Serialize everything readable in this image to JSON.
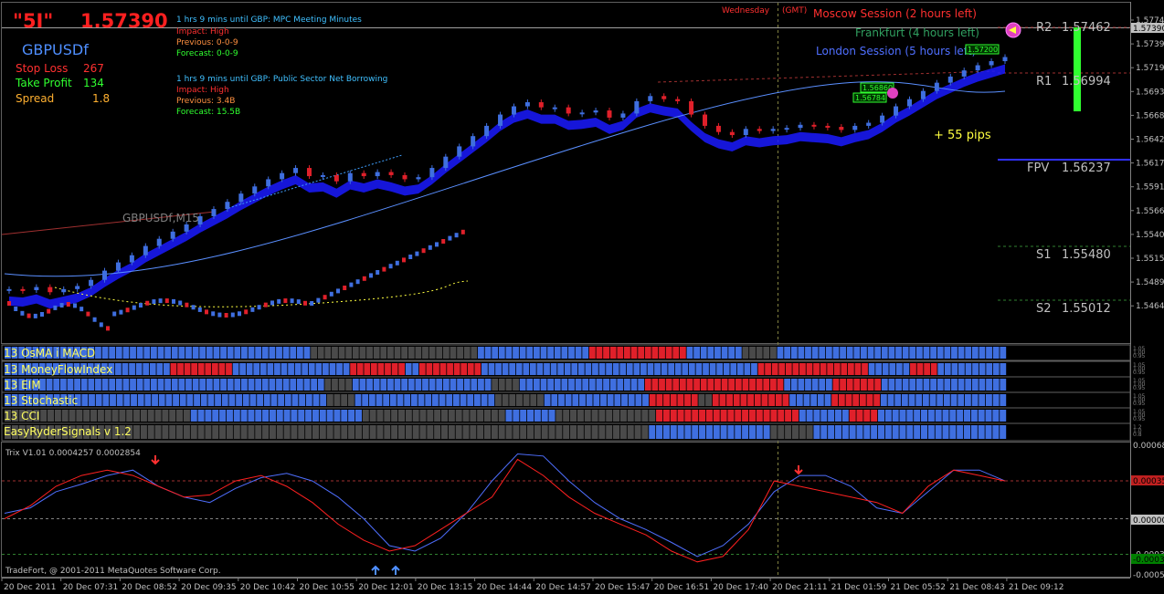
{
  "header": {
    "symbol_big": "\"5I\"",
    "price_big": "1.57390",
    "pair": "GBPUSDf",
    "stop_loss_label": "Stop Loss",
    "stop_loss_value": "267",
    "take_profit_label": "Take Profit",
    "take_profit_value": "134",
    "spread_label": "Spread",
    "spread_value": "1.8"
  },
  "news": [
    {
      "title": "1 hrs 9 mins until GBP: MPC Meeting Minutes",
      "impact": "Impact: High",
      "previous": "Previous: 0-0-9",
      "forecast": "Forecast: 0-0-9"
    },
    {
      "title": "1 hrs 9 mins until GBP: Public Sector Net Borrowing",
      "impact": "Impact: High",
      "previous": "Previous: 3.4B",
      "forecast": "Forecast: 15.5B"
    }
  ],
  "sessions": {
    "day": "Wednesday",
    "gmt": "(GMT)",
    "moscow": "Moscow Session (2 hours left)",
    "frankfurt": "Frankfurt (4 hours left)",
    "london": "London Session (5 hours left)"
  },
  "annotations": {
    "pips": "+ 55 pips",
    "watermark": "GBPUSDf,M15",
    "box1": "1.56860",
    "box2": "1.56784",
    "box3": "1.57200"
  },
  "pivots": [
    {
      "name": "R2",
      "value": "1.57462"
    },
    {
      "name": "R1",
      "value": "1.56994"
    },
    {
      "name": "FPV",
      "value": "1.56237"
    },
    {
      "name": "S1",
      "value": "1.55480"
    },
    {
      "name": "S2",
      "value": "1.55012"
    }
  ],
  "price_axis": [
    "1.57746",
    "1.57390",
    "1.57190",
    "1.56935",
    "1.56680",
    "1.56425",
    "1.56170",
    "1.55915",
    "1.55660",
    "1.55405",
    "1.55150",
    "1.54895",
    "1.54640"
  ],
  "current_price_tag": "1.57390",
  "indicators": [
    {
      "label": "13 OsMA i MACD",
      "levels": [
        "1.05",
        "1.00",
        "0.95"
      ]
    },
    {
      "label": "13 MoneyFlowIndex",
      "levels": [
        "1.05",
        "1.00",
        "0.95"
      ]
    },
    {
      "label": "13 EIM",
      "levels": [
        "1.05",
        "1.00",
        "0.95"
      ]
    },
    {
      "label": "13 Stochastic",
      "levels": [
        "1.05",
        "1.00",
        "0.95"
      ]
    },
    {
      "label": "13 CCI",
      "levels": [
        "1.05",
        "1.00",
        "0.95"
      ]
    },
    {
      "label": "EasyRyderSignals v 1.2",
      "levels": [
        "1.2",
        "1.0",
        "0.8"
      ]
    }
  ],
  "trix": {
    "label": "Trix V1.01 0.0004257 0.0002854",
    "axis": [
      "0.00068",
      "0.00035",
      "0.00000",
      "-0.00033",
      "-0.00052"
    ],
    "tags": {
      "upper": "0.00035",
      "zero": "0.00000",
      "lower": "-0.0003"
    }
  },
  "time_axis": [
    "20 Dec 2011",
    "20 Dec 07:31",
    "20 Dec 08:52",
    "20 Dec 09:35",
    "20 Dec 10:42",
    "20 Dec 10:55",
    "20 Dec 12:01",
    "20 Dec 13:15",
    "20 Dec 14:44",
    "20 Dec 14:57",
    "20 Dec 15:47",
    "20 Dec 16:51",
    "20 Dec 17:40",
    "20 Dec 21:11",
    "21 Dec 01:59",
    "21 Dec 05:52",
    "21 Dec 08:43",
    "21 Dec 09:12"
  ],
  "footer": "TradeFort, @ 2001-2011 MetaQuotes Software Corp.",
  "colors": {
    "up": "#3f6fe0",
    "down": "#e0202a",
    "grey": "#4a4a4a",
    "axis": "#c0c0c0",
    "accent_red": "#ff2020"
  },
  "chart_data": [
    {
      "type": "candlestick",
      "title": "GBPUSDf,M15",
      "ylim": [
        1.5464,
        1.5775
      ],
      "close": [
        1.5513,
        1.5512,
        1.5515,
        1.551,
        1.5513,
        1.5516,
        1.5522,
        1.5531,
        1.5539,
        1.5546,
        1.5555,
        1.5562,
        1.5569,
        1.5576,
        1.5584,
        1.5591,
        1.5598,
        1.5606,
        1.5613,
        1.562,
        1.5626,
        1.5631,
        1.5623,
        1.5624,
        1.5618,
        1.5626,
        1.5623,
        1.5627,
        1.5624,
        1.562,
        1.5622,
        1.5631,
        1.5642,
        1.5652,
        1.5662,
        1.5672,
        1.5683,
        1.5691,
        1.5695,
        1.569,
        1.569,
        1.5684,
        1.5685,
        1.5687,
        1.568,
        1.5684,
        1.5696,
        1.5701,
        1.5698,
        1.5696,
        1.5683,
        1.5672,
        1.5666,
        1.5663,
        1.5669,
        1.5667,
        1.5669,
        1.567,
        1.5673,
        1.5672,
        1.5671,
        1.5668,
        1.5672,
        1.5675,
        1.5682,
        1.5691,
        1.5698,
        1.5706,
        1.5714,
        1.572,
        1.5726,
        1.5731,
        1.5735,
        1.5739
      ]
    },
    {
      "type": "line",
      "title": "Trix V1.01 0.0004257 0.0002854",
      "ylim": [
        -0.00052,
        0.00068
      ],
      "series": [
        {
          "values": [
            5e-05,
            0.0001,
            0.00025,
            0.00032,
            0.0004,
            0.00045,
            0.0003,
            0.0002,
            0.00015,
            0.00028,
            0.00038,
            0.00042,
            0.00035,
            0.0002,
            0.0,
            -0.00025,
            -0.0003,
            -0.00018,
            5e-05,
            0.00035,
            0.0006,
            0.00058,
            0.00035,
            0.00015,
            0.0,
            -0.0001,
            -0.00022,
            -0.00035,
            -0.00025,
            -5e-05,
            0.00025,
            0.0004,
            0.0004,
            0.0003,
            0.0001,
            5e-05,
            0.00025,
            0.00045,
            0.00045,
            0.00035
          ]
        },
        {
          "values": [
            0.0,
            0.00012,
            0.0003,
            0.0004,
            0.00045,
            0.0004,
            0.0003,
            0.0002,
            0.00022,
            0.00035,
            0.0004,
            0.0003,
            0.00015,
            -5e-05,
            -0.0002,
            -0.0003,
            -0.00025,
            -0.0001,
            5e-05,
            0.0002,
            0.00055,
            0.0004,
            0.0002,
            5e-05,
            -5e-05,
            -0.00015,
            -0.0003,
            -0.0004,
            -0.00035,
            -0.0001,
            0.00035,
            0.0003,
            0.00025,
            0.0002,
            0.00015,
            5e-05,
            0.0003,
            0.00045,
            0.0004,
            0.00035
          ]
        }
      ]
    }
  ]
}
